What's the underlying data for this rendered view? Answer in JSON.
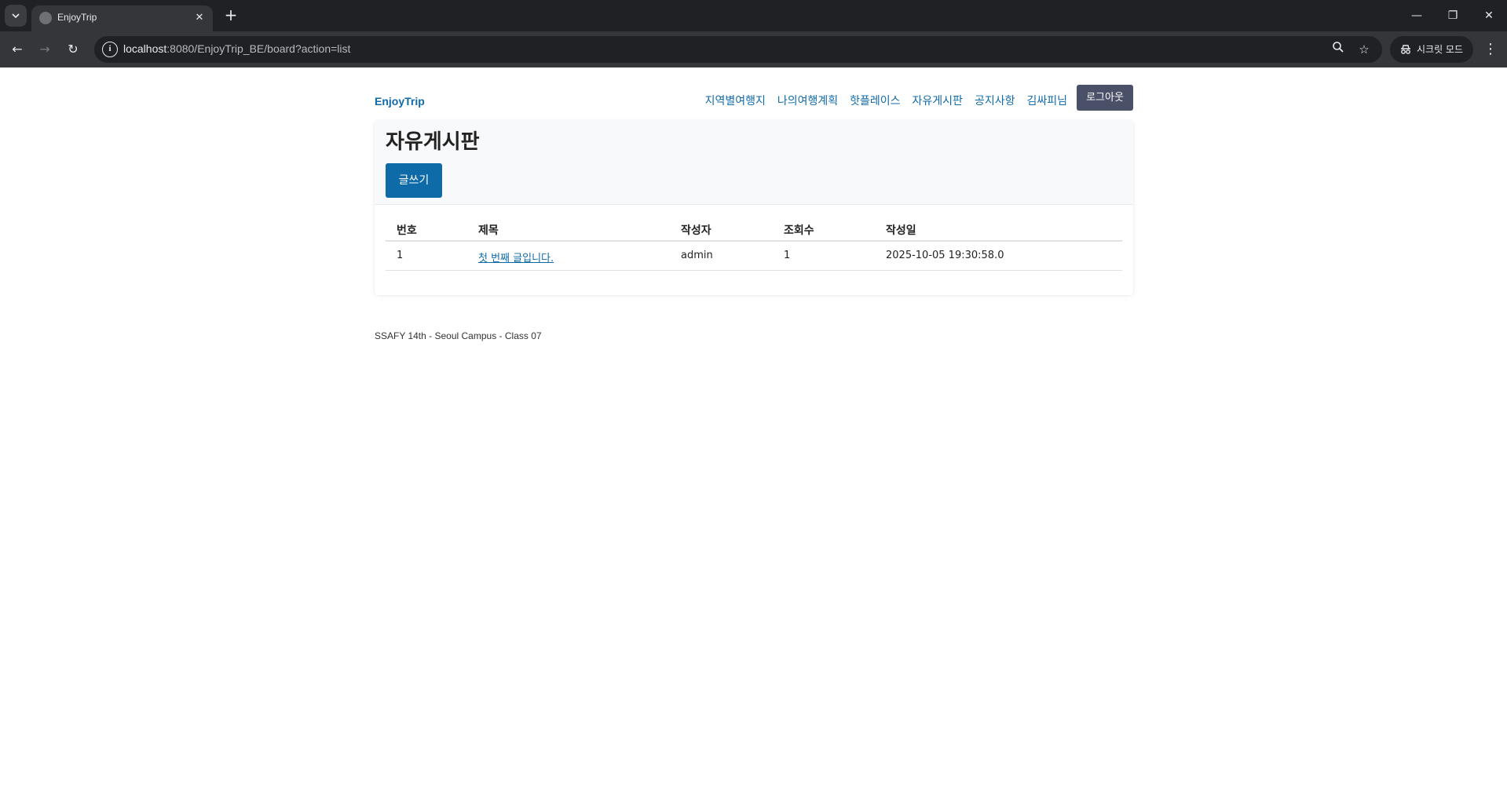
{
  "browser": {
    "tab_title": "EnjoyTrip",
    "url_host": "localhost",
    "url_rest": ":8080/EnjoyTrip_BE/board?action=list",
    "incognito_label": "시크릿 모드"
  },
  "navbar": {
    "brand": "EnjoyTrip",
    "links": [
      {
        "label": "지역별여행지"
      },
      {
        "label": "나의여행계획"
      },
      {
        "label": "핫플레이스"
      },
      {
        "label": "자유게시판"
      },
      {
        "label": "공지사항"
      },
      {
        "label": "김싸피님"
      }
    ],
    "logout_label": "로그아웃"
  },
  "board": {
    "title": "자유게시판",
    "write_label": "글쓰기",
    "columns": [
      "번호",
      "제목",
      "작성자",
      "조회수",
      "작성일"
    ],
    "rows": [
      {
        "no": "1",
        "title": "첫 번째 글입니다.",
        "author": "admin",
        "views": "1",
        "date": "2025-10-05 19:30:58.0"
      }
    ]
  },
  "footer": {
    "text": "SSAFY 14th - Seoul Campus - Class 07"
  },
  "colors": {
    "accent": "#0f6aa8",
    "logout_bg": "#4a5068",
    "chrome_dark": "#202124",
    "chrome_toolbar": "#35363a"
  },
  "icons": [
    "tab-search-icon",
    "globe-favicon-icon",
    "close-icon",
    "plus-icon",
    "minimize-icon",
    "restore-icon",
    "window-close-icon",
    "back-icon",
    "forward-icon",
    "reload-icon",
    "site-info-icon",
    "zoom-icon",
    "star-icon",
    "incognito-icon",
    "more-menu-icon"
  ]
}
